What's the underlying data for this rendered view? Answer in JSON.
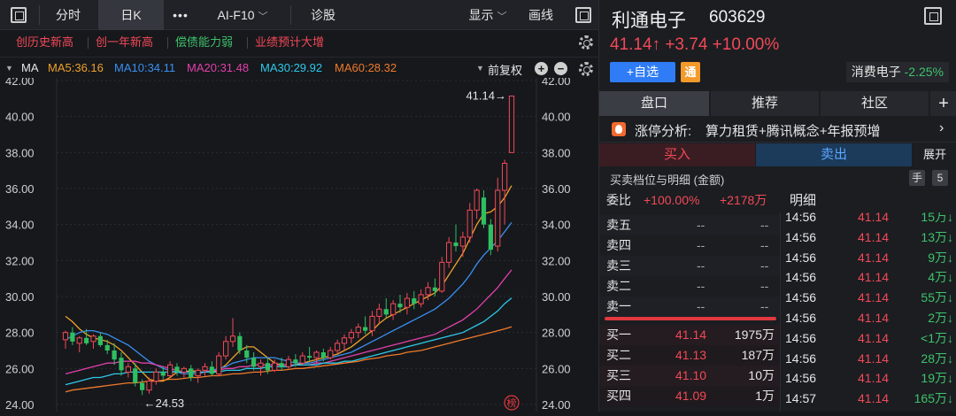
{
  "toolbar": {
    "tabs": [
      "分时",
      "日K",
      "•••",
      "AI-F10",
      "诊股"
    ],
    "display_label": "显示",
    "draw_label": "画线"
  },
  "tags": [
    {
      "label": "创历史新高",
      "color": "#f24957"
    },
    {
      "label": "创一年新高",
      "color": "#f24957"
    },
    {
      "label": "偿债能力弱",
      "color": "#3ec26b"
    },
    {
      "label": "业绩预计大增",
      "color": "#f24957"
    }
  ],
  "ma_row": {
    "label": "MA",
    "items": [
      {
        "label": "MA5:36.16",
        "color": "#f0a12a"
      },
      {
        "label": "MA10:34.11",
        "color": "#3b8ff0"
      },
      {
        "label": "MA20:31.48",
        "color": "#e040a8"
      },
      {
        "label": "MA30:29.92",
        "color": "#2ec8e8"
      },
      {
        "label": "MA60:28.32",
        "color": "#f07a2a"
      }
    ],
    "adjust_label": "前复权"
  },
  "chart_data": {
    "type": "candlestick",
    "ylim": [
      24,
      42
    ],
    "y_ticks": [
      "42.00",
      "40.00",
      "38.00",
      "36.00",
      "34.00",
      "32.00",
      "30.00",
      "28.00",
      "26.00",
      "24.00"
    ],
    "last_price_label": "41.14→",
    "low_label": "←24.53",
    "rank_badge": "榜",
    "candles": [
      {
        "o": 27.6,
        "h": 28.1,
        "l": 27.1,
        "c": 28.0
      },
      {
        "o": 28.0,
        "h": 28.3,
        "l": 27.3,
        "c": 27.5
      },
      {
        "o": 27.4,
        "h": 27.8,
        "l": 26.9,
        "c": 27.7
      },
      {
        "o": 27.7,
        "h": 28.2,
        "l": 27.3,
        "c": 27.4
      },
      {
        "o": 27.5,
        "h": 27.9,
        "l": 27.1,
        "c": 27.8
      },
      {
        "o": 27.8,
        "h": 28.0,
        "l": 27.2,
        "c": 27.3
      },
      {
        "o": 27.3,
        "h": 27.6,
        "l": 26.8,
        "c": 27.0
      },
      {
        "o": 27.0,
        "h": 27.4,
        "l": 26.2,
        "c": 26.5
      },
      {
        "o": 26.6,
        "h": 26.9,
        "l": 25.6,
        "c": 25.9
      },
      {
        "o": 25.8,
        "h": 26.3,
        "l": 25.5,
        "c": 26.1
      },
      {
        "o": 26.0,
        "h": 26.3,
        "l": 25.0,
        "c": 25.2
      },
      {
        "o": 25.2,
        "h": 25.4,
        "l": 24.53,
        "c": 24.8
      },
      {
        "o": 24.8,
        "h": 25.5,
        "l": 24.6,
        "c": 25.3
      },
      {
        "o": 25.3,
        "h": 26.0,
        "l": 25.1,
        "c": 25.8
      },
      {
        "o": 25.8,
        "h": 26.1,
        "l": 25.4,
        "c": 25.6
      },
      {
        "o": 25.6,
        "h": 26.4,
        "l": 25.5,
        "c": 26.2
      },
      {
        "o": 26.1,
        "h": 26.3,
        "l": 25.6,
        "c": 25.8
      },
      {
        "o": 25.8,
        "h": 26.1,
        "l": 25.5,
        "c": 26.0
      },
      {
        "o": 26.0,
        "h": 26.2,
        "l": 25.3,
        "c": 25.5
      },
      {
        "o": 25.6,
        "h": 26.0,
        "l": 25.2,
        "c": 25.9
      },
      {
        "o": 25.9,
        "h": 26.3,
        "l": 25.6,
        "c": 26.1
      },
      {
        "o": 26.1,
        "h": 26.4,
        "l": 25.6,
        "c": 25.7
      },
      {
        "o": 25.7,
        "h": 26.9,
        "l": 25.6,
        "c": 26.7
      },
      {
        "o": 26.7,
        "h": 27.8,
        "l": 26.5,
        "c": 27.5
      },
      {
        "o": 27.5,
        "h": 28.8,
        "l": 27.2,
        "c": 27.8
      },
      {
        "o": 27.8,
        "h": 28.0,
        "l": 26.8,
        "c": 27.0
      },
      {
        "o": 27.0,
        "h": 27.3,
        "l": 26.3,
        "c": 26.6
      },
      {
        "o": 26.6,
        "h": 26.9,
        "l": 25.9,
        "c": 26.1
      },
      {
        "o": 26.1,
        "h": 26.5,
        "l": 25.6,
        "c": 26.3
      },
      {
        "o": 26.3,
        "h": 26.6,
        "l": 25.7,
        "c": 25.9
      },
      {
        "o": 25.9,
        "h": 26.5,
        "l": 25.8,
        "c": 26.3
      },
      {
        "o": 26.3,
        "h": 26.6,
        "l": 25.9,
        "c": 26.1
      },
      {
        "o": 26.1,
        "h": 26.7,
        "l": 26.0,
        "c": 26.5
      },
      {
        "o": 26.5,
        "h": 26.8,
        "l": 26.1,
        "c": 26.3
      },
      {
        "o": 26.3,
        "h": 26.9,
        "l": 26.2,
        "c": 26.7
      },
      {
        "o": 26.7,
        "h": 27.2,
        "l": 26.4,
        "c": 26.6
      },
      {
        "o": 26.6,
        "h": 27.0,
        "l": 26.3,
        "c": 26.9
      },
      {
        "o": 26.9,
        "h": 27.1,
        "l": 26.4,
        "c": 26.6
      },
      {
        "o": 26.6,
        "h": 27.2,
        "l": 26.5,
        "c": 27.0
      },
      {
        "o": 27.0,
        "h": 27.6,
        "l": 26.8,
        "c": 27.4
      },
      {
        "o": 27.4,
        "h": 27.9,
        "l": 27.0,
        "c": 27.7
      },
      {
        "o": 27.7,
        "h": 28.2,
        "l": 27.4,
        "c": 28.0
      },
      {
        "o": 28.0,
        "h": 28.5,
        "l": 27.7,
        "c": 28.3
      },
      {
        "o": 28.3,
        "h": 28.9,
        "l": 27.9,
        "c": 28.1
      },
      {
        "o": 28.1,
        "h": 29.2,
        "l": 27.8,
        "c": 28.9
      },
      {
        "o": 28.9,
        "h": 29.6,
        "l": 28.5,
        "c": 29.3
      },
      {
        "o": 29.3,
        "h": 29.9,
        "l": 28.8,
        "c": 29.0
      },
      {
        "o": 29.0,
        "h": 29.8,
        "l": 28.7,
        "c": 29.6
      },
      {
        "o": 29.6,
        "h": 30.1,
        "l": 29.1,
        "c": 29.4
      },
      {
        "o": 29.4,
        "h": 30.2,
        "l": 29.0,
        "c": 29.9
      },
      {
        "o": 29.9,
        "h": 30.3,
        "l": 29.3,
        "c": 29.6
      },
      {
        "o": 29.6,
        "h": 30.4,
        "l": 29.4,
        "c": 30.1
      },
      {
        "o": 30.1,
        "h": 30.8,
        "l": 29.8,
        "c": 30.5
      },
      {
        "o": 30.5,
        "h": 31.0,
        "l": 30.0,
        "c": 30.3
      },
      {
        "o": 30.3,
        "h": 32.2,
        "l": 30.2,
        "c": 31.9
      },
      {
        "o": 31.9,
        "h": 33.3,
        "l": 31.6,
        "c": 33.0
      },
      {
        "o": 33.0,
        "h": 34.0,
        "l": 32.5,
        "c": 32.8
      },
      {
        "o": 32.8,
        "h": 33.6,
        "l": 32.2,
        "c": 33.3
      },
      {
        "o": 33.3,
        "h": 35.2,
        "l": 33.0,
        "c": 34.8
      },
      {
        "o": 34.8,
        "h": 36.0,
        "l": 34.3,
        "c": 35.9
      },
      {
        "o": 35.5,
        "h": 35.9,
        "l": 33.8,
        "c": 34.0
      },
      {
        "o": 34.0,
        "h": 34.3,
        "l": 32.3,
        "c": 32.6
      },
      {
        "o": 32.8,
        "h": 36.6,
        "l": 32.5,
        "c": 35.9
      },
      {
        "o": 35.9,
        "h": 37.6,
        "l": 34.0,
        "c": 37.4
      },
      {
        "o": 38.0,
        "h": 41.14,
        "l": 38.0,
        "c": 41.14
      }
    ],
    "ma_lines": [
      {
        "name": "MA5",
        "color": "#f0a12a",
        "values": [
          28.9,
          28.6,
          28.2,
          27.9,
          27.7,
          27.6,
          27.5,
          27.3,
          27.0,
          26.6,
          26.2,
          25.8,
          25.4,
          25.3,
          25.3,
          25.5,
          25.8,
          25.8,
          25.9,
          25.8,
          25.8,
          25.8,
          25.9,
          26.2,
          26.6,
          27.0,
          27.2,
          27.2,
          26.9,
          26.6,
          26.3,
          26.2,
          26.2,
          26.2,
          26.3,
          26.4,
          26.5,
          26.6,
          26.7,
          26.8,
          27.0,
          27.2,
          27.5,
          27.8,
          28.1,
          28.5,
          28.8,
          29.0,
          29.2,
          29.4,
          29.6,
          29.8,
          30.0,
          30.2,
          30.6,
          31.2,
          31.8,
          32.4,
          33.2,
          34.0,
          34.6,
          34.7,
          35.0,
          35.5,
          36.16
        ]
      },
      {
        "name": "MA10",
        "color": "#3b8ff0",
        "values": [
          27.6,
          27.8,
          28.0,
          28.1,
          28.1,
          28.0,
          27.9,
          27.7,
          27.5,
          27.3,
          27.0,
          26.7,
          26.4,
          26.2,
          26.0,
          25.9,
          25.8,
          25.7,
          25.7,
          25.7,
          25.8,
          25.9,
          26.0,
          26.1,
          26.3,
          26.4,
          26.5,
          26.6,
          26.6,
          26.6,
          26.6,
          26.5,
          26.4,
          26.3,
          26.3,
          26.3,
          26.4,
          26.5,
          26.6,
          26.7,
          26.8,
          26.9,
          27.1,
          27.3,
          27.5,
          27.7,
          27.9,
          28.1,
          28.3,
          28.5,
          28.7,
          28.9,
          29.1,
          29.3,
          29.6,
          29.9,
          30.3,
          30.7,
          31.2,
          31.8,
          32.3,
          32.7,
          33.1,
          33.6,
          34.11
        ]
      },
      {
        "name": "MA20",
        "color": "#e040a8",
        "values": [
          25.7,
          25.8,
          25.9,
          26.0,
          26.1,
          26.2,
          26.3,
          26.3,
          26.4,
          26.4,
          26.4,
          26.3,
          26.3,
          26.2,
          26.1,
          26.0,
          25.9,
          25.8,
          25.8,
          25.8,
          25.8,
          25.9,
          25.9,
          26.0,
          26.0,
          26.1,
          26.1,
          26.2,
          26.2,
          26.2,
          26.2,
          26.2,
          26.2,
          26.2,
          26.2,
          26.2,
          26.3,
          26.3,
          26.4,
          26.5,
          26.6,
          26.7,
          26.8,
          26.9,
          27.0,
          27.1,
          27.2,
          27.3,
          27.4,
          27.5,
          27.6,
          27.7,
          27.8,
          27.9,
          28.1,
          28.3,
          28.5,
          28.7,
          29.0,
          29.3,
          29.7,
          30.1,
          30.5,
          31.0,
          31.48
        ]
      },
      {
        "name": "MA30",
        "color": "#2ec8e8",
        "values": [
          25.1,
          25.2,
          25.3,
          25.4,
          25.5,
          25.5,
          25.6,
          25.7,
          25.7,
          25.8,
          25.8,
          25.8,
          25.8,
          25.8,
          25.8,
          25.8,
          25.8,
          25.8,
          25.8,
          25.8,
          25.8,
          25.8,
          25.8,
          25.9,
          25.9,
          25.9,
          26.0,
          26.0,
          26.0,
          26.1,
          26.1,
          26.1,
          26.1,
          26.2,
          26.2,
          26.2,
          26.2,
          26.3,
          26.3,
          26.3,
          26.4,
          26.4,
          26.5,
          26.6,
          26.7,
          26.8,
          26.9,
          27.0,
          27.1,
          27.2,
          27.3,
          27.4,
          27.5,
          27.6,
          27.7,
          27.8,
          27.9,
          28.0,
          28.2,
          28.4,
          28.6,
          28.9,
          29.2,
          29.6,
          29.92
        ]
      },
      {
        "name": "MA60",
        "color": "#f07a2a",
        "values": [
          24.7,
          24.8,
          24.85,
          24.9,
          24.95,
          25.0,
          25.05,
          25.1,
          25.15,
          25.2,
          25.2,
          25.25,
          25.3,
          25.3,
          25.35,
          25.4,
          25.4,
          25.45,
          25.5,
          25.5,
          25.55,
          25.6,
          25.6,
          25.65,
          25.7,
          25.7,
          25.75,
          25.8,
          25.8,
          25.85,
          25.9,
          25.9,
          25.95,
          26.0,
          26.0,
          26.05,
          26.1,
          26.15,
          26.2,
          26.25,
          26.3,
          26.35,
          26.4,
          26.5,
          26.55,
          26.6,
          26.7,
          26.75,
          26.8,
          26.9,
          26.95,
          27.0,
          27.1,
          27.2,
          27.3,
          27.4,
          27.5,
          27.6,
          27.7,
          27.8,
          27.9,
          28.0,
          28.1,
          28.2,
          28.32
        ]
      }
    ]
  },
  "stock": {
    "name": "利通电子",
    "code": "603629",
    "price": "41.14↑",
    "change": "+3.74",
    "change_pct": "+10.00%",
    "add_label": "+自选",
    "tong_label": "通",
    "sector_name": "消费电子",
    "sector_change": "-2.25%"
  },
  "tabs": [
    "盘口",
    "推荐",
    "社区"
  ],
  "analysis": {
    "prefix": "涨停分析:",
    "text": "算力租赁+腾讯概念+年报预增"
  },
  "buy_label": "买入",
  "sell_label": "卖出",
  "expand_label": "展开",
  "section_title": "买卖档位与明细 (金额)",
  "hand_label": "手",
  "count_label": "5",
  "weibi": {
    "label": "委比",
    "pct": "+100.00%",
    "amount": "+2178万"
  },
  "detail_label": "明细",
  "sell_levels": [
    {
      "label": "卖五",
      "price": "--",
      "vol": "--"
    },
    {
      "label": "卖四",
      "price": "--",
      "vol": "--"
    },
    {
      "label": "卖三",
      "price": "--",
      "vol": "--"
    },
    {
      "label": "卖二",
      "price": "--",
      "vol": "--"
    },
    {
      "label": "卖一",
      "price": "--",
      "vol": "--"
    }
  ],
  "buy_levels": [
    {
      "label": "买一",
      "price": "41.14",
      "vol": "1975万"
    },
    {
      "label": "买二",
      "price": "41.13",
      "vol": "187万"
    },
    {
      "label": "买三",
      "price": "41.10",
      "vol": "10万"
    },
    {
      "label": "买四",
      "price": "41.09",
      "vol": "1万"
    }
  ],
  "details": [
    {
      "time": "14:56",
      "price": "41.14",
      "vol": "15万↓"
    },
    {
      "time": "14:56",
      "price": "41.14",
      "vol": "13万↓"
    },
    {
      "time": "14:56",
      "price": "41.14",
      "vol": "9万↓"
    },
    {
      "time": "14:56",
      "price": "41.14",
      "vol": "4万↓"
    },
    {
      "time": "14:56",
      "price": "41.14",
      "vol": "55万↓"
    },
    {
      "time": "14:56",
      "price": "41.14",
      "vol": "2万↓"
    },
    {
      "time": "14:56",
      "price": "41.14",
      "vol": "<1万↓"
    },
    {
      "time": "14:56",
      "price": "41.14",
      "vol": "28万↓"
    },
    {
      "time": "14:56",
      "price": "41.14",
      "vol": "19万↓"
    },
    {
      "time": "14:57",
      "price": "41.14",
      "vol": "165万↓"
    }
  ]
}
